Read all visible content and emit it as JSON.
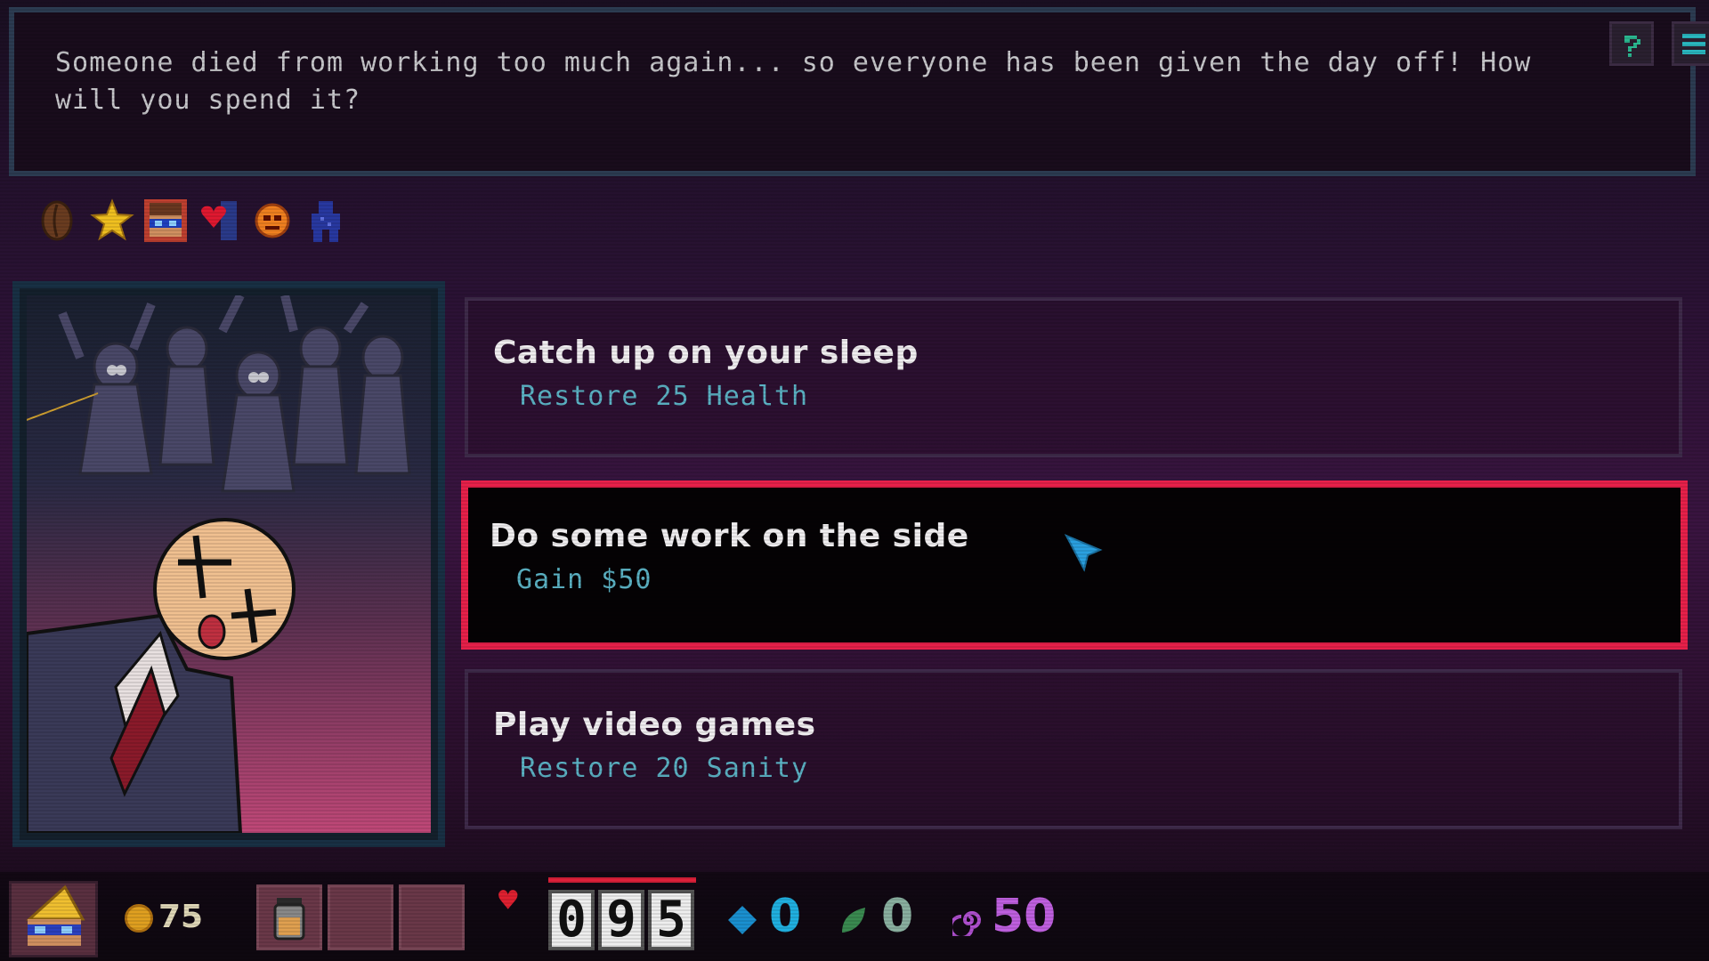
{
  "dialog": {
    "text": "Someone died from working too much again... so everyone has been given the day off! How will you spend it?"
  },
  "header_buttons": {
    "help_icon": "question-icon",
    "menu_icon": "hamburger-menu-icon"
  },
  "status_icons": [
    "coffee-bean-icon",
    "star-icon",
    "character-portrait-icon",
    "heart-bandaid-icon",
    "orange-mask-icon",
    "blue-figure-icon"
  ],
  "choices": [
    {
      "title": "Catch up on your sleep",
      "desc": "Restore 25 Health",
      "selected": false
    },
    {
      "title": "Do some work on the side",
      "desc": "Gain $50",
      "selected": true
    },
    {
      "title": "Play video games",
      "desc": "Restore 20 Sanity",
      "selected": false
    }
  ],
  "bottom": {
    "coins": "75",
    "health_digits": [
      "0",
      "9",
      "5"
    ],
    "blue_stat": "0",
    "leaf_stat": "0",
    "spiral_stat": "50"
  },
  "colors": {
    "selected_border": "#e8204a",
    "desc": "#5bb2c4",
    "dialog_border": "#2c3c52"
  }
}
